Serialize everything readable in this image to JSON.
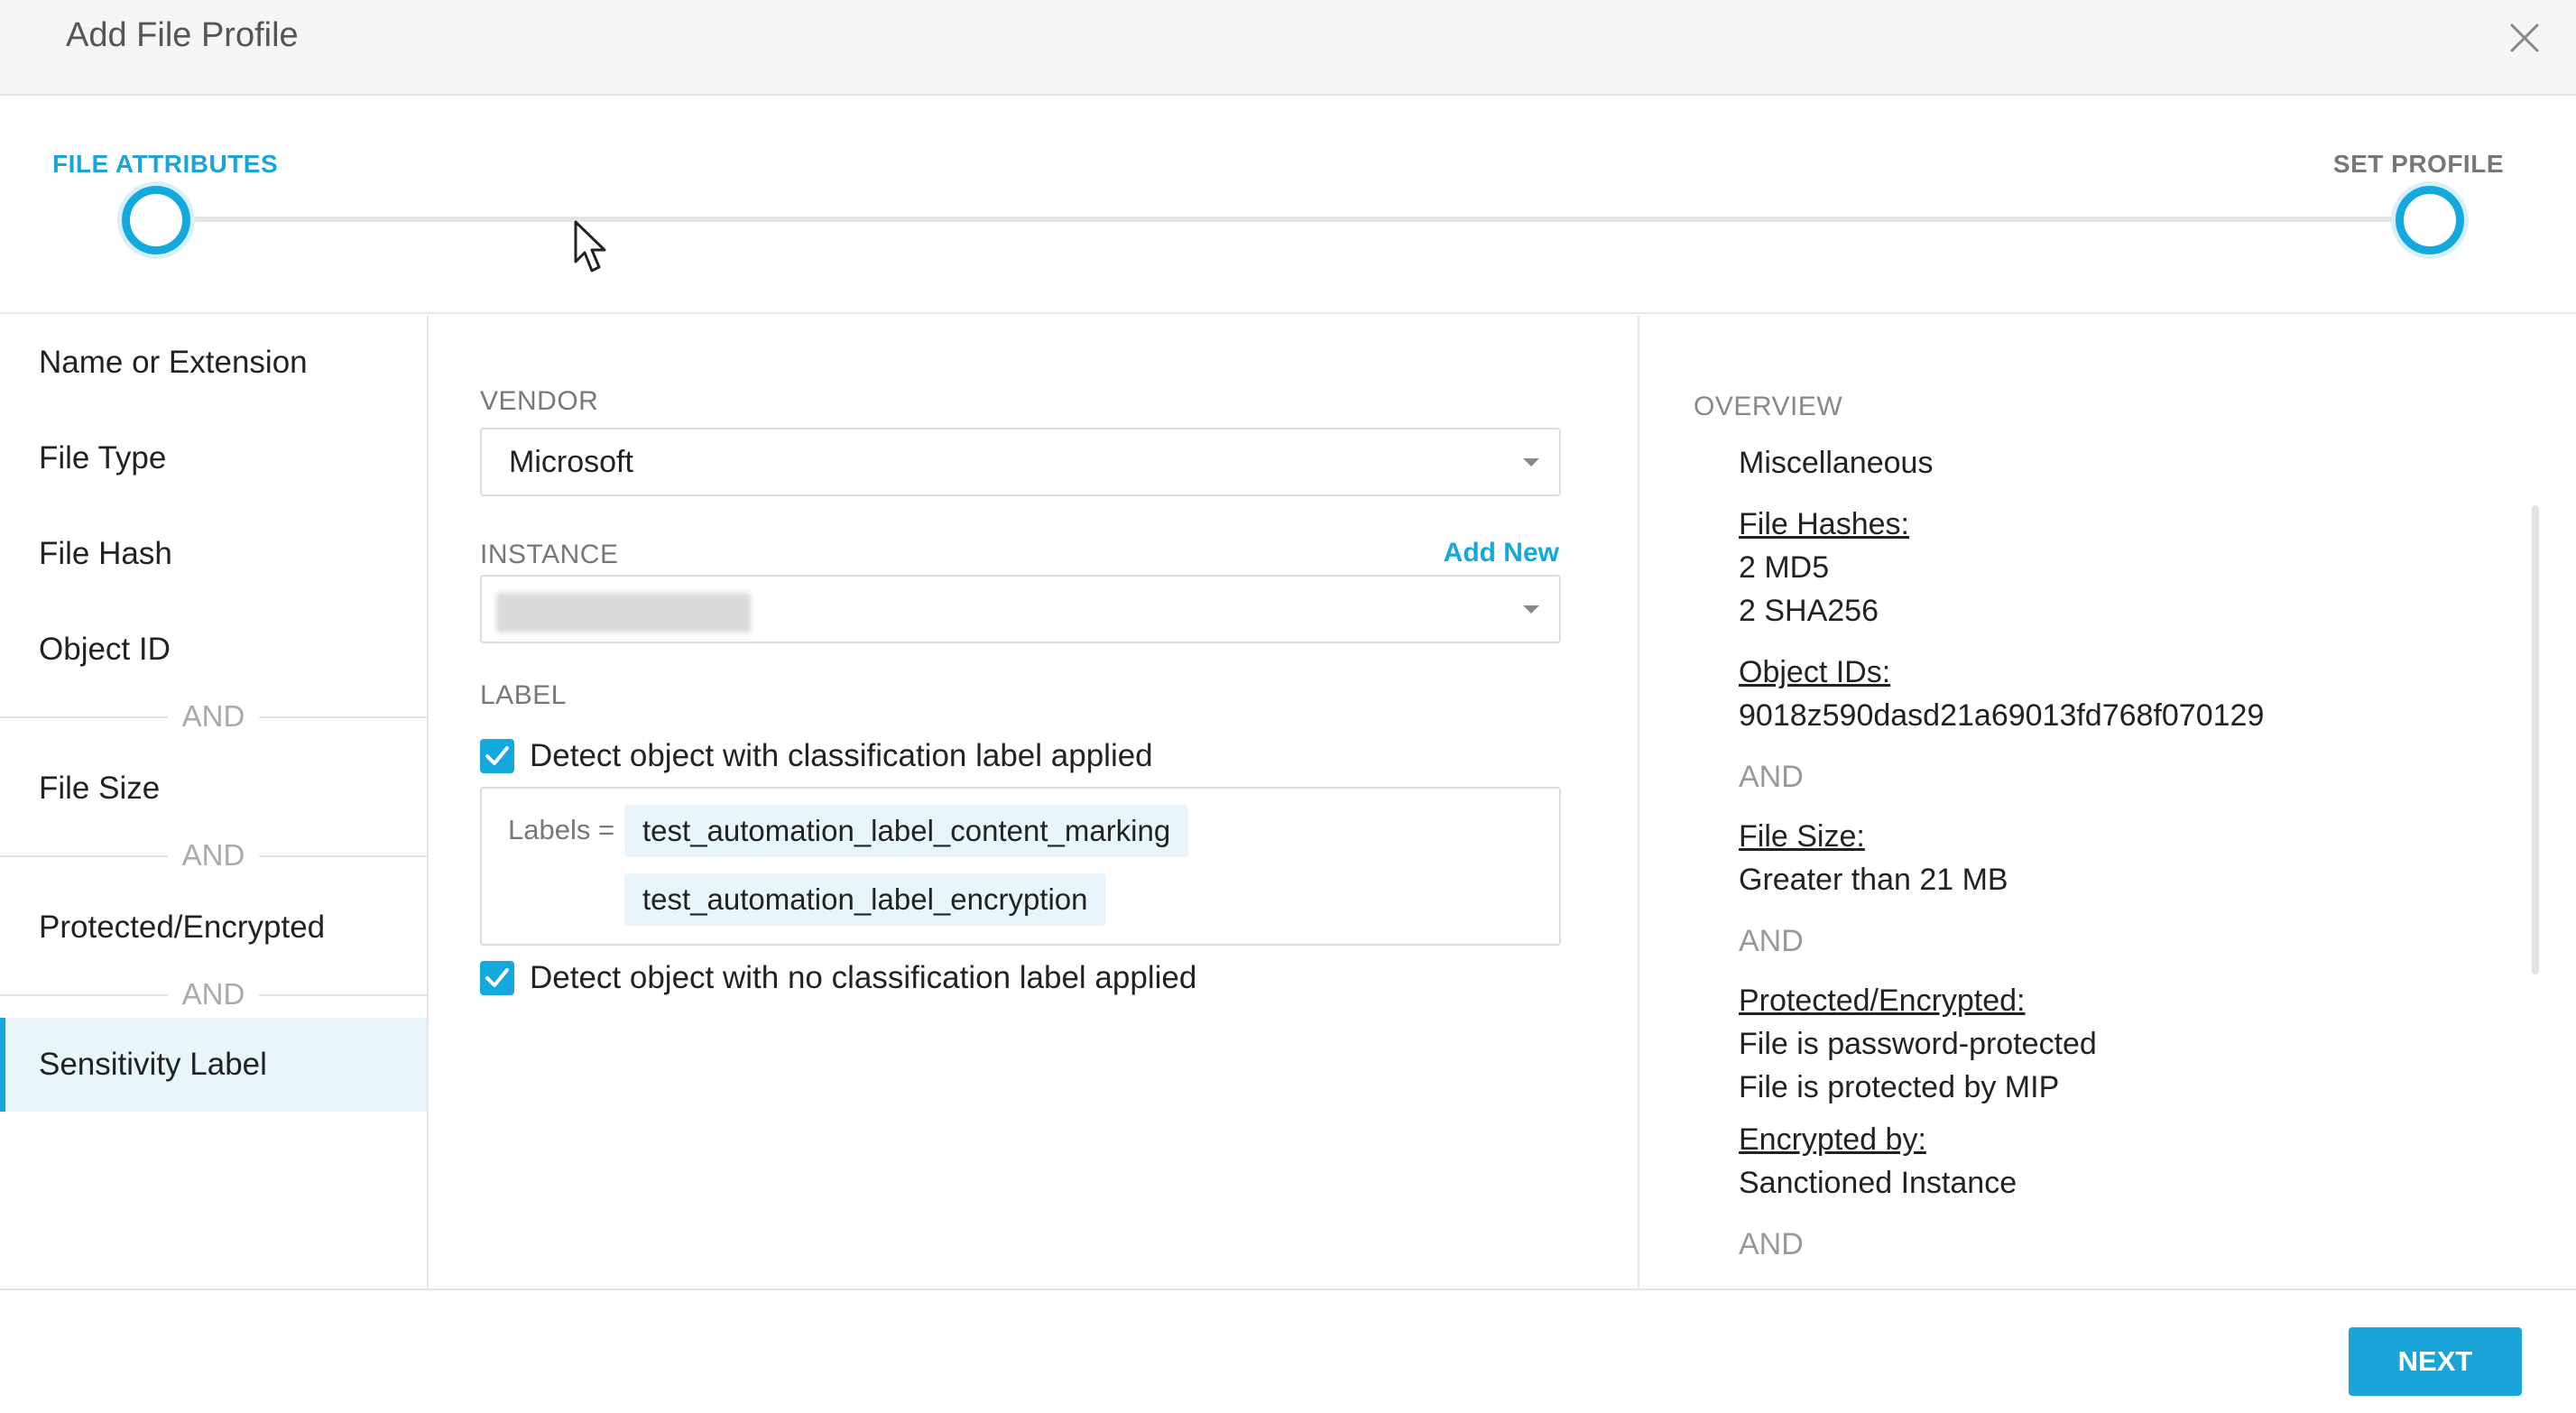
{
  "header": {
    "title": "Add File Profile"
  },
  "stepper": {
    "step1": "FILE ATTRIBUTES",
    "step2": "SET PROFILE"
  },
  "nav": {
    "items": [
      "Name or Extension",
      "File Type",
      "File Hash",
      "Object ID",
      "File Size",
      "Protected/Encrypted",
      "Sensitivity Label"
    ],
    "and": "AND",
    "active": "Sensitivity Label"
  },
  "form": {
    "vendor_label": "VENDOR",
    "vendor_value": "Microsoft",
    "instance_label": "INSTANCE",
    "add_new": "Add New",
    "label_label": "LABEL",
    "check1": "Detect object with classification label applied",
    "labels_eq": "Labels =",
    "chips": [
      "test_automation_label_content_marking",
      "test_automation_label_encryption"
    ],
    "check2": "Detect object with no classification label applied"
  },
  "overview": {
    "title": "OVERVIEW",
    "misc": "Miscellaneous",
    "file_hashes_head": "File Hashes:",
    "md5": "2 MD5",
    "sha256": "2 SHA256",
    "object_ids_head": "Object IDs:",
    "object_id": "9018z590dasd21a69013fd768f070129",
    "and": "AND",
    "file_size_head": "File Size:",
    "file_size": "Greater than 21 MB",
    "protected_head": "Protected/Encrypted:",
    "protected1": "File is password-protected",
    "protected2": "File is protected by MIP",
    "encrypted_by_head": "Encrypted by:",
    "encrypted_by": "Sanctioned Instance"
  },
  "footer": {
    "next": "NEXT"
  },
  "colors": {
    "accent": "#14a9dd",
    "active_bg": "#e8f5fb"
  }
}
